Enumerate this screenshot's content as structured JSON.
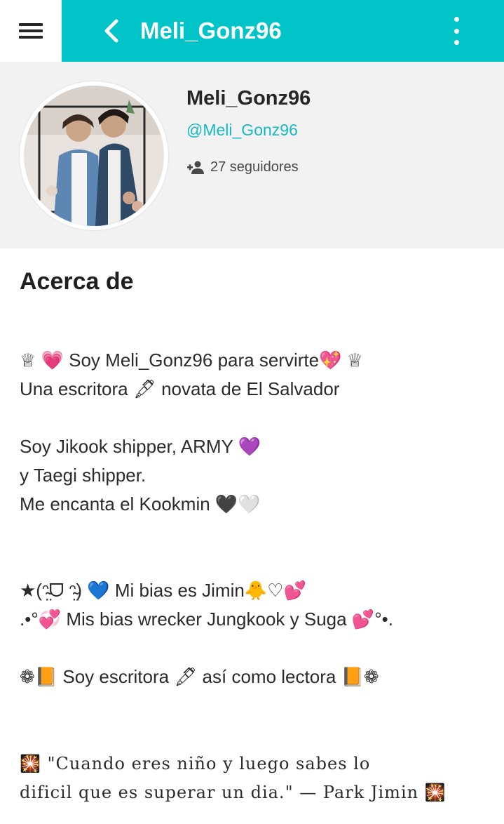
{
  "header": {
    "title": "Meli_Gonz96"
  },
  "profile": {
    "name": "Meli_Gonz96",
    "handle": "@Meli_Gonz96",
    "followers_text": "27 seguidores"
  },
  "about": {
    "title": "Acerca de",
    "lines": [
      "♕ 💗 Soy Meli_Gonz96 para servirte💖 ♕",
      "Una escritora 🖋 novata de El Salvador",
      "Soy Jikook shipper, ARMY 💜",
      "y Taegi shipper.",
      "Me encanta el Kookmin 🖤🤍",
      "★(ᵔ̴̤ᗜ ᵔ̴̤) 💙 Mi bias es Jimin🐥♡💕",
      ".•°💞 Mis bias wrecker Jungkook y Suga 💕°•.",
      "❁📙 Soy escritora 🖋 así como lectora 📙❁",
      "🎇 \"Cuando eres niño y luego sabes lo",
      "dificil que es superar un dia.\" — Park Jimin 🎇"
    ]
  },
  "colors": {
    "header_bg": "#00c4c8",
    "handle": "#15b9c4",
    "profile_bg": "#f2f2f2"
  },
  "icons": [
    "menu-icon",
    "back-arrow-icon",
    "more-vert-icon",
    "add-person-icon"
  ]
}
